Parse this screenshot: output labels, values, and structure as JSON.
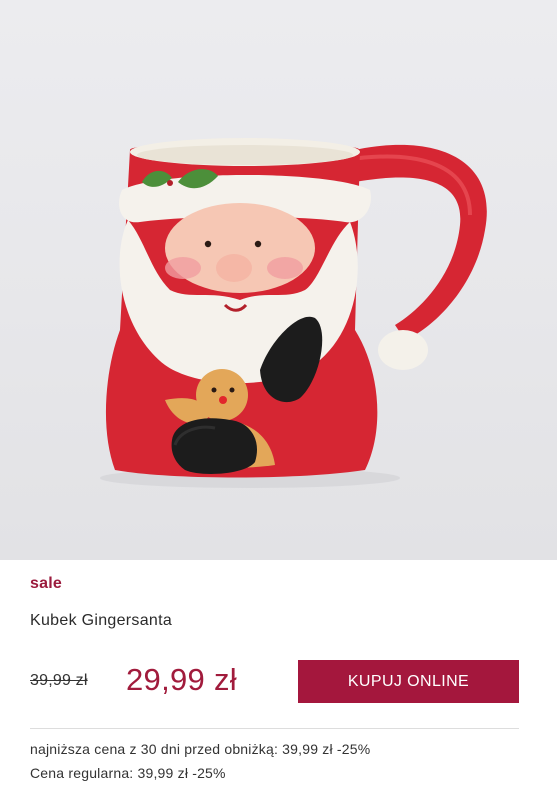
{
  "product": {
    "badge": "sale",
    "title": "Kubek Gingersanta",
    "old_price": "39,99  zł",
    "new_price": "29,99 zł",
    "buy_label": "KUPUJ ONLINE",
    "lowest_price_note": "najniższa cena z 30 dni przed obniżką: 39,99  zł -25%",
    "regular_price_note": "Cena regularna: 39,99 zł -25%",
    "image_label": "product-photo-santa-mug"
  },
  "colors": {
    "accent": "#a4173d",
    "price": "#a11b3c",
    "mug_red": "#d62633",
    "background": "#e9e9ec"
  }
}
